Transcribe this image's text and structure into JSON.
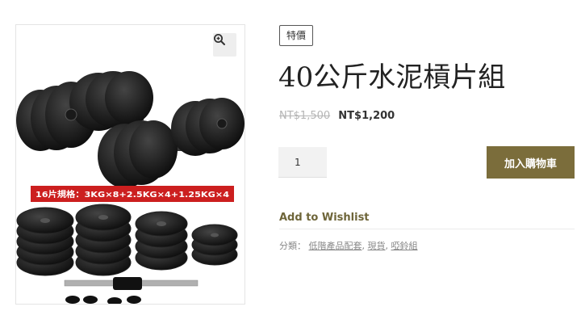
{
  "gallery": {
    "spec_banner": "16片規格：3KG×8+2.5KG×4+1.25KG×4",
    "zoom_icon": "zoom-in-icon"
  },
  "product": {
    "badge": "特價",
    "title": "40公斤水泥槓片組",
    "price_old": "NT$1,500",
    "price_new": "NT$1,200",
    "quantity": "1",
    "add_to_cart": "加入購物車",
    "wishlist": "Add to Wishlist",
    "categories_label": "分類：",
    "categories": [
      "低階產品配套",
      "現貨",
      "啞鈴組"
    ]
  },
  "colors": {
    "accent": "#7b6d3b",
    "wishlist": "#6e6539",
    "banner": "#cc1f1f"
  }
}
